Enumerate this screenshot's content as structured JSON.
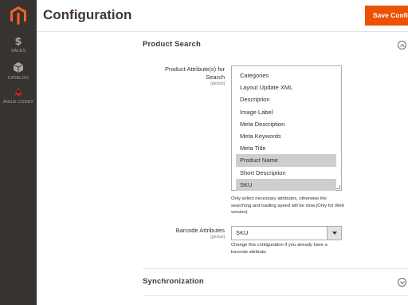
{
  "sidebar": {
    "items": [
      {
        "label": "SALES",
        "icon": "dollar-icon",
        "glyph": "$"
      },
      {
        "label": "CATALOG",
        "icon": "cube-icon"
      },
      {
        "label": "AGILE CODEX",
        "icon": "agile-codex-icon"
      }
    ]
  },
  "header": {
    "title": "Configuration",
    "save_label": "Save Config"
  },
  "sections": {
    "product_search": {
      "title": "Product Search",
      "expanded": true,
      "attributes_field": {
        "label": "Product Attribute(s) for Search",
        "scope": "[global]",
        "options": [
          {
            "label": "Categories",
            "selected": false
          },
          {
            "label": "Layout Update XML",
            "selected": false
          },
          {
            "label": "Description",
            "selected": false
          },
          {
            "label": "Image Label",
            "selected": false
          },
          {
            "label": "Meta Description",
            "selected": false
          },
          {
            "label": "Meta Keywords",
            "selected": false
          },
          {
            "label": "Meta Title",
            "selected": false
          },
          {
            "label": "Product Name",
            "selected": true
          },
          {
            "label": "Short Description",
            "selected": false
          },
          {
            "label": "SKU",
            "selected": true
          }
        ],
        "note": "Only select necessary attributes, otherwise the searching and loading speed will be slow.(Only for Web version)"
      },
      "barcode_field": {
        "label": "Barcode Attributes",
        "scope": "[global]",
        "value": "SKU",
        "note": "Change this configuration if you already have a barcode attribute."
      }
    },
    "synchronization": {
      "title": "Synchronization",
      "expanded": false
    }
  },
  "colors": {
    "accent": "#eb5202",
    "sidebar_bg": "#373330",
    "selected_option": "#cecece"
  }
}
